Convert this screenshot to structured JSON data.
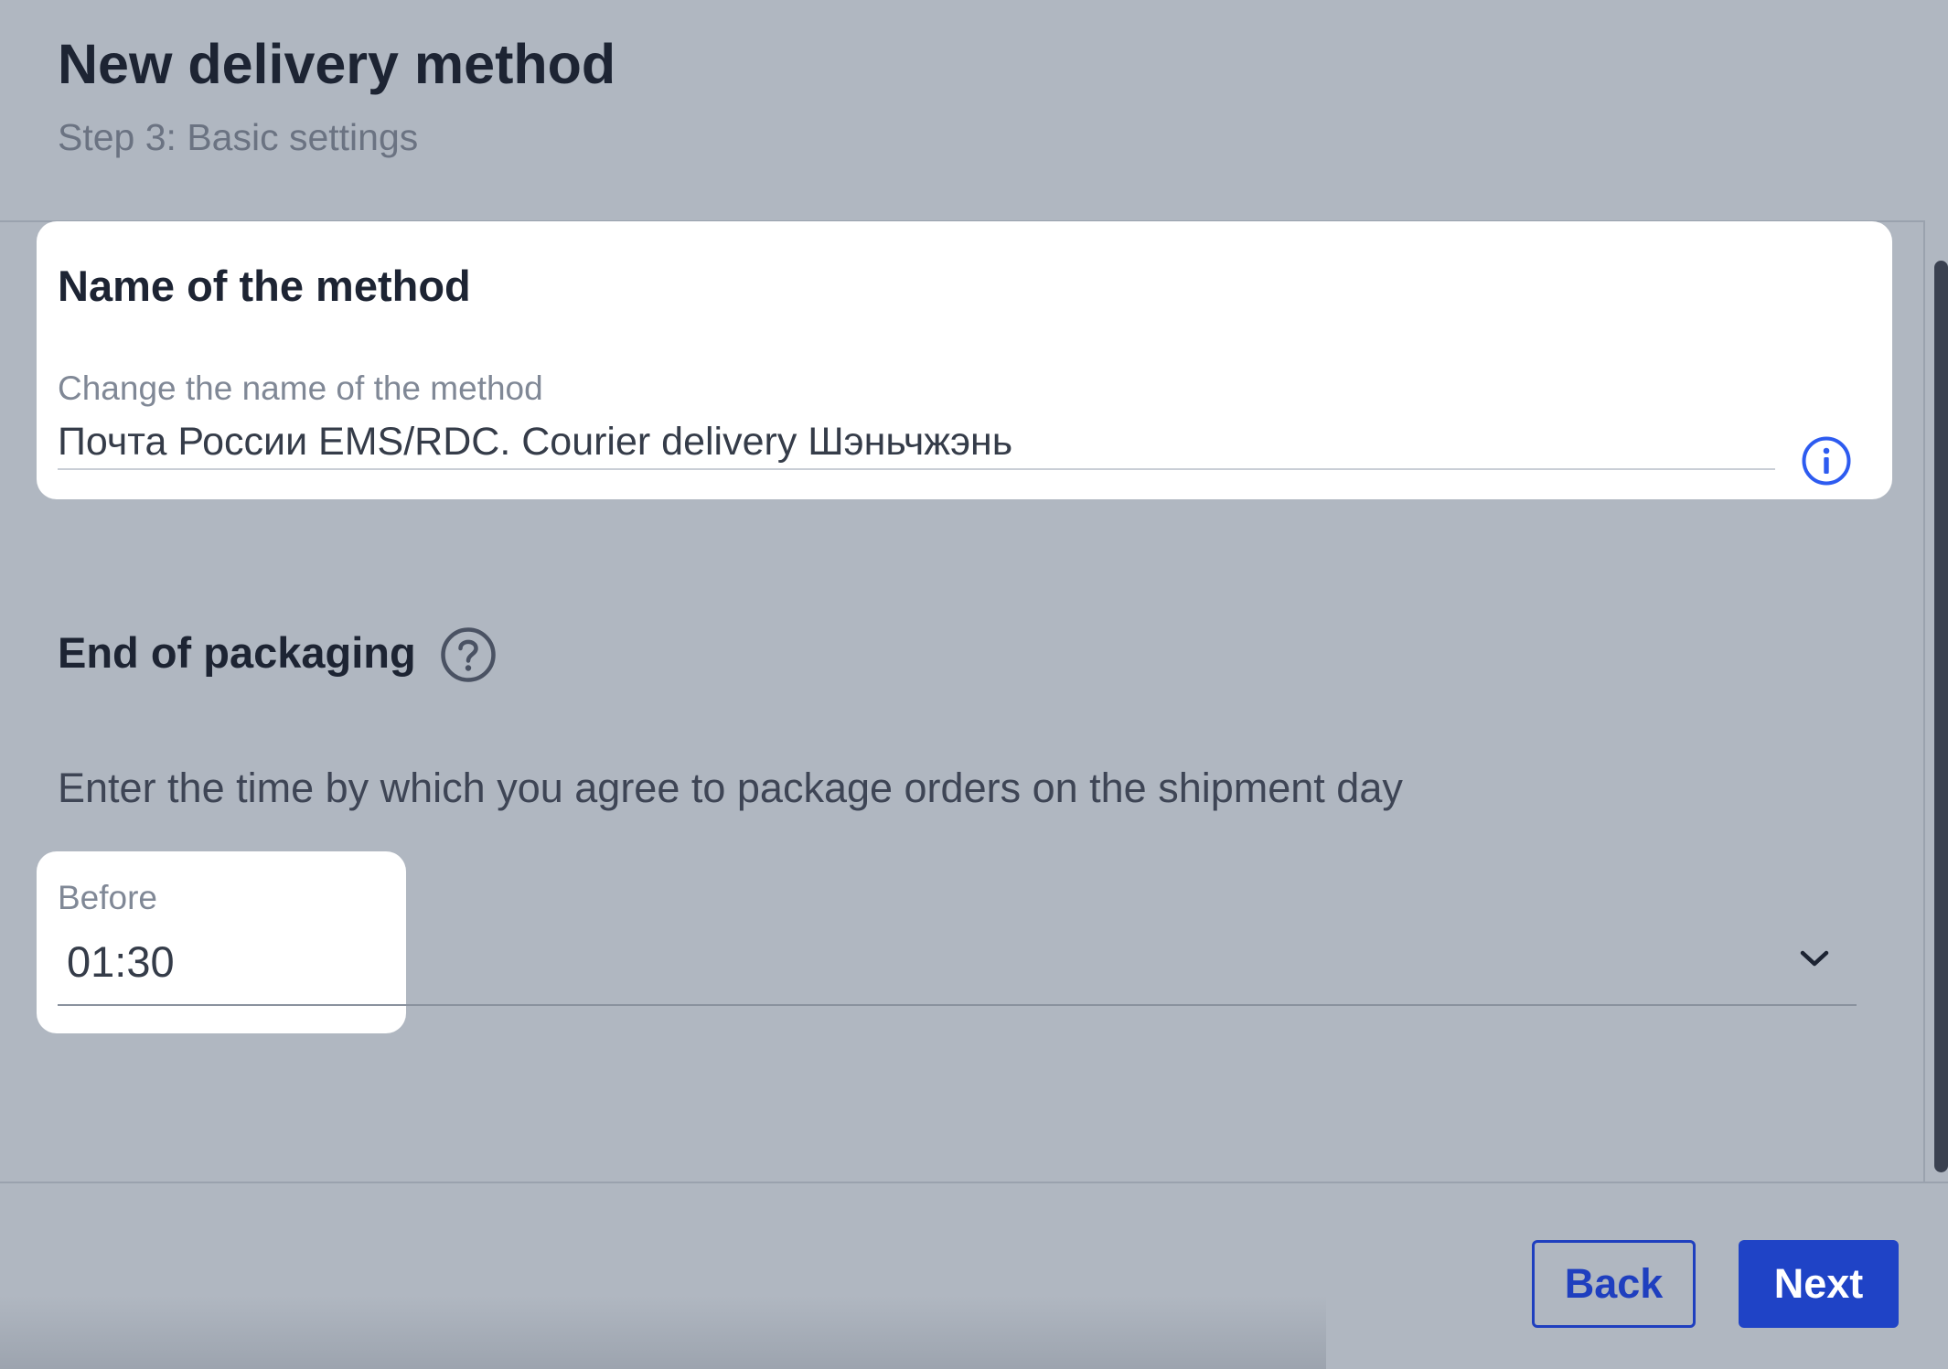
{
  "header": {
    "title": "New delivery method",
    "subtitle": "Step 3: Basic settings"
  },
  "name_section": {
    "title": "Name of the method",
    "field_label": "Change the name of the method",
    "field_value": "Почта России EMS/RDC. Courier delivery Шэньчжэнь",
    "info_icon": "info-circle-icon"
  },
  "packaging_section": {
    "title": "End of packaging",
    "help_icon": "question-circle-icon",
    "description": "Enter the time by which you agree to package orders on the shipment day",
    "before_label": "Before",
    "before_value": "01:30",
    "dropdown_icon": "chevron-down-icon"
  },
  "footer": {
    "back_label": "Back",
    "next_label": "Next"
  },
  "colors": {
    "overlay_background": "#b0b7c1",
    "accent": "#1f43c6",
    "info_icon": "#2d5bf0",
    "title_text": "#1d2433"
  }
}
